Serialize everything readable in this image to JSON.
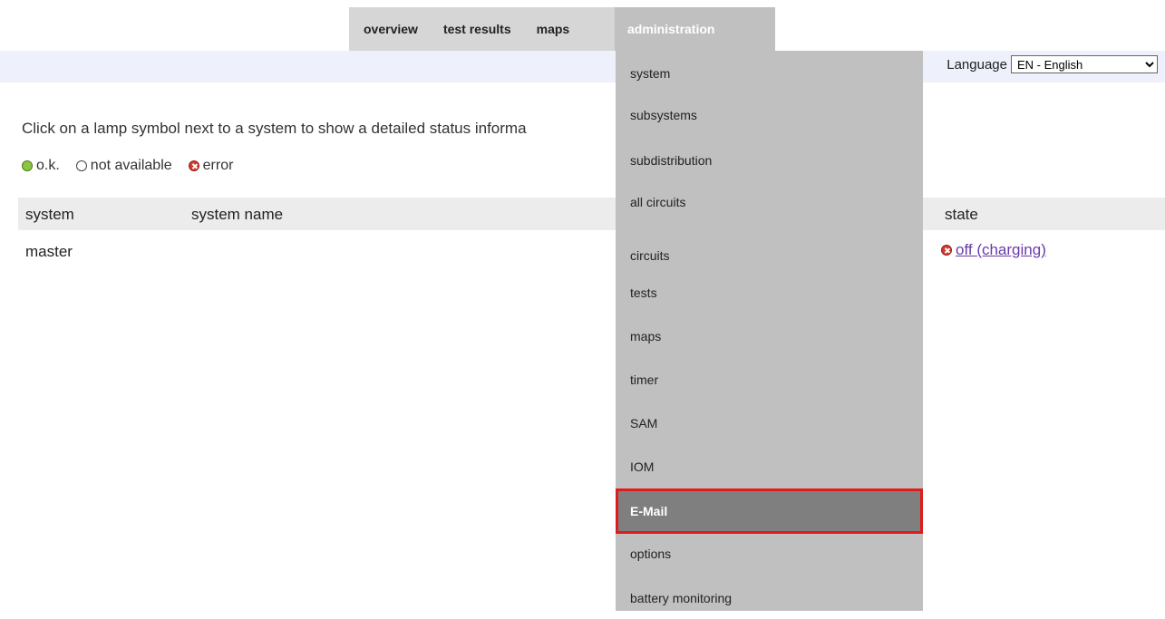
{
  "nav": {
    "tabs": [
      {
        "label": "overview"
      },
      {
        "label": "test results"
      },
      {
        "label": "maps"
      },
      {
        "label": "administration"
      }
    ]
  },
  "language": {
    "label": "Language",
    "selected": "EN - English"
  },
  "intro": "Click on a lamp symbol next to a system to show a detailed status informa",
  "legend": {
    "ok": "o.k.",
    "na": "not available",
    "error": "error"
  },
  "table": {
    "headers": {
      "system": "system",
      "system_name": "system name",
      "state": "state"
    },
    "rows": [
      {
        "system": "master",
        "system_name": "",
        "state": "off (charging)"
      }
    ]
  },
  "admin_menu": {
    "items": [
      {
        "label": "system"
      },
      {
        "label": "subsystems"
      },
      {
        "label": "subdistribution"
      },
      {
        "label": "all circuits"
      },
      {
        "label": "circuits"
      },
      {
        "label": "tests"
      },
      {
        "label": "maps"
      },
      {
        "label": "timer"
      },
      {
        "label": "SAM"
      },
      {
        "label": "IOM"
      },
      {
        "label": "E-Mail"
      },
      {
        "label": "options"
      },
      {
        "label": "battery monitoring"
      }
    ],
    "selected_index": 10
  },
  "colors": {
    "selected_outline": "#e01b1b",
    "link": "#6a3aa8",
    "ok_lamp": "#8cc63f",
    "error_lamp": "#d23a2f"
  }
}
